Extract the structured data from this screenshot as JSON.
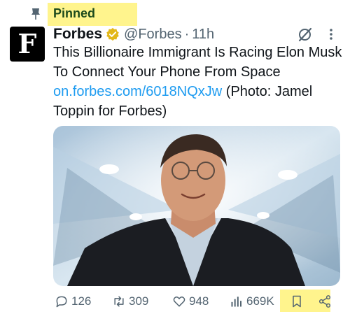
{
  "pinned": {
    "label": "Pinned"
  },
  "author": {
    "display_name": "Forbes",
    "avatar_letter": "F",
    "verified": true,
    "handle": "@Forbes",
    "separator": "·",
    "time": "11h"
  },
  "tweet": {
    "text": "This Billionaire Immigrant Is Racing Elon Musk To Connect Your Phone From Space",
    "link": "on.forbes.com/6018NQxJw",
    "caption": "(Photo: Jamel Toppin for Forbes)"
  },
  "metrics": {
    "replies": "126",
    "reposts": "309",
    "likes": "948",
    "views": "669K"
  },
  "icons": [
    "pin-icon",
    "verified-badge-icon",
    "grok-icon",
    "more-icon",
    "reply-icon",
    "repost-icon",
    "like-icon",
    "views-icon",
    "bookmark-icon",
    "share-icon"
  ],
  "colors": {
    "highlight": "#fff48d",
    "link": "#1d9bf0",
    "secondary_text": "#536471",
    "verified_gold": "#e2b719"
  }
}
